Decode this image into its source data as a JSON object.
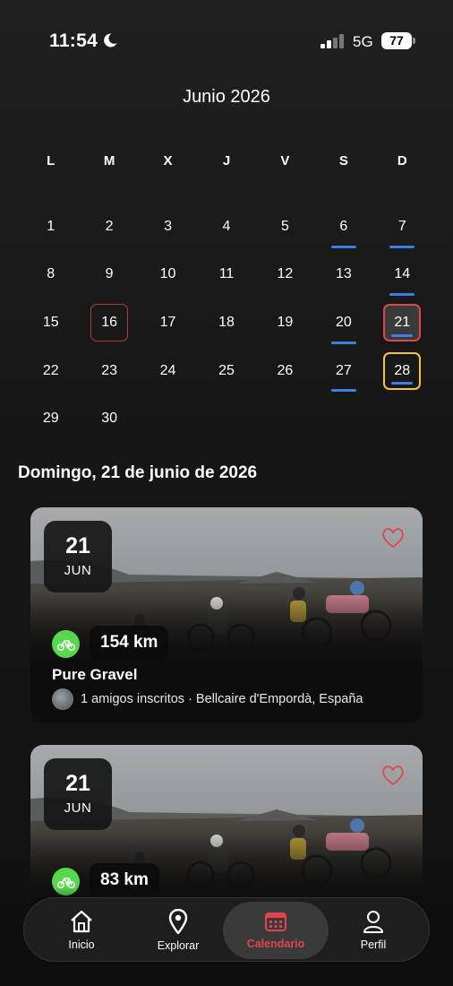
{
  "status_bar": {
    "time": "11:54",
    "network": "5G",
    "battery": "77"
  },
  "calendar": {
    "month_title": "Junio 2026",
    "weekdays": [
      "L",
      "M",
      "X",
      "J",
      "V",
      "S",
      "D"
    ],
    "days": [
      {
        "n": "1"
      },
      {
        "n": "2"
      },
      {
        "n": "3"
      },
      {
        "n": "4"
      },
      {
        "n": "5"
      },
      {
        "n": "6",
        "event": true
      },
      {
        "n": "7",
        "event": true
      },
      {
        "n": "8"
      },
      {
        "n": "9"
      },
      {
        "n": "10"
      },
      {
        "n": "11"
      },
      {
        "n": "12"
      },
      {
        "n": "13"
      },
      {
        "n": "14",
        "event": true
      },
      {
        "n": "15"
      },
      {
        "n": "16",
        "today": true
      },
      {
        "n": "17"
      },
      {
        "n": "18"
      },
      {
        "n": "19"
      },
      {
        "n": "20",
        "event": true
      },
      {
        "n": "21",
        "event": true,
        "selected": true
      },
      {
        "n": "22"
      },
      {
        "n": "23"
      },
      {
        "n": "24"
      },
      {
        "n": "25"
      },
      {
        "n": "26"
      },
      {
        "n": "27",
        "event": true
      },
      {
        "n": "28",
        "event": true,
        "next": true
      },
      {
        "n": "29"
      },
      {
        "n": "30"
      }
    ]
  },
  "selected_date_heading": "Domingo, 21 de junio de 2026",
  "events": [
    {
      "day": "21",
      "month": "JUN",
      "distance": "154 km",
      "title": "Pure Gravel",
      "meta": "1 amigos inscritos · Bellcaire d'Empordà, España"
    },
    {
      "day": "21",
      "month": "JUN",
      "distance": "83 km",
      "title": "",
      "meta": ""
    }
  ],
  "nav": {
    "items": [
      {
        "label": "Inicio",
        "icon": "home-icon"
      },
      {
        "label": "Explorar",
        "icon": "location-pin-icon"
      },
      {
        "label": "Calendario",
        "icon": "calendar-icon",
        "active": true
      },
      {
        "label": "Perfil",
        "icon": "user-icon"
      }
    ]
  },
  "colors": {
    "accent_red": "#e0454c",
    "event_blue": "#3a7ee8",
    "next_yellow": "#f2c44a",
    "bike_green": "#55d84a"
  }
}
